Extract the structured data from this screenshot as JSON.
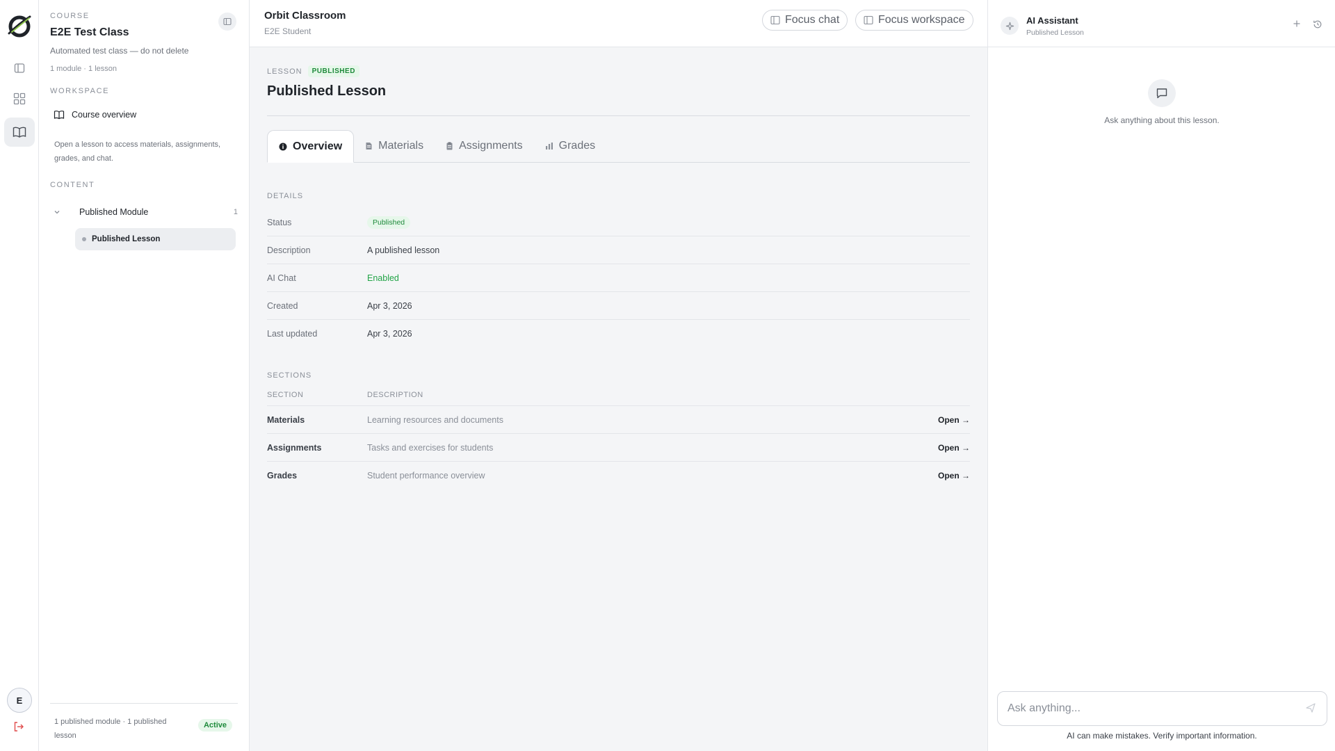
{
  "rail": {
    "logo": "orbit-logo",
    "items": [
      "panel-icon",
      "grid-icon",
      "book-icon"
    ],
    "avatar_initial": "E",
    "logout_icon": "logout-icon"
  },
  "course": {
    "section_label": "COURSE",
    "title": "E2E Test Class",
    "subtitle": "Automated test class — do not delete",
    "meta": "1 module · 1 lesson",
    "workspace_label": "WORKSPACE",
    "workspace_item": "Course overview",
    "workspace_help": "Open a lesson to access materials, assignments, grades, and chat.",
    "content_label": "CONTENT",
    "module": {
      "name": "Published Module",
      "count": "1"
    },
    "lesson": "Published Lesson",
    "footer_text": "1 published module · 1 published lesson",
    "footer_badge": "Active"
  },
  "header": {
    "title": "Orbit Classroom",
    "subtitle": "E2E Student",
    "focus_chat": "Focus chat",
    "focus_workspace": "Focus workspace"
  },
  "lesson": {
    "kicker": "LESSON",
    "badge": "PUBLISHED",
    "title": "Published Lesson",
    "tabs": [
      {
        "label": "Overview",
        "icon": "info-icon"
      },
      {
        "label": "Materials",
        "icon": "document-icon"
      },
      {
        "label": "Assignments",
        "icon": "clipboard-icon"
      },
      {
        "label": "Grades",
        "icon": "bar-chart-icon"
      }
    ],
    "details_label": "DETAILS",
    "details": [
      {
        "label": "Status",
        "value": "Published"
      },
      {
        "label": "Description",
        "value": "A published lesson"
      },
      {
        "label": "AI Chat",
        "value": "Enabled"
      },
      {
        "label": "Created",
        "value": "Apr 3, 2026"
      },
      {
        "label": "Last updated",
        "value": "Apr 3, 2026"
      }
    ],
    "sections_label": "SECTIONS",
    "sections_columns": [
      "SECTION",
      "DESCRIPTION"
    ],
    "sections": [
      {
        "name": "Materials",
        "description": "Learning resources and documents",
        "action": "Open →"
      },
      {
        "name": "Assignments",
        "description": "Tasks and exercises for students",
        "action": "Open →"
      },
      {
        "name": "Grades",
        "description": "Student performance overview",
        "action": "Open →"
      }
    ]
  },
  "assistant": {
    "title": "AI Assistant",
    "subtitle": "Published Lesson",
    "empty_text": "Ask anything about this lesson.",
    "input_placeholder": "Ask anything...",
    "disclaimer": "AI can make mistakes. Verify important information."
  },
  "colors": {
    "accent_green": "#22a447",
    "badge_green_bg": "#e6f7ea",
    "logout_red": "#e04b4b"
  }
}
